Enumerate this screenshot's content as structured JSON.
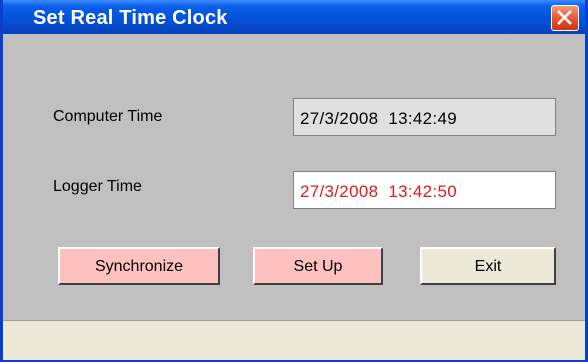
{
  "window": {
    "title": "Set Real Time Clock"
  },
  "computer_time": {
    "label": "Computer Time",
    "value": "27/3/2008  13:42:49"
  },
  "logger_time": {
    "label": "Logger Time",
    "value": "27/3/2008  13:42:50"
  },
  "buttons": {
    "synchronize": "Synchronize",
    "setup": "Set Up",
    "exit": "Exit"
  },
  "colors": {
    "titlebar": "#0450d8",
    "logger_value": "#e11b1b",
    "action_button": "#ffc0c0"
  },
  "icons": {
    "close": "close-x-icon"
  }
}
